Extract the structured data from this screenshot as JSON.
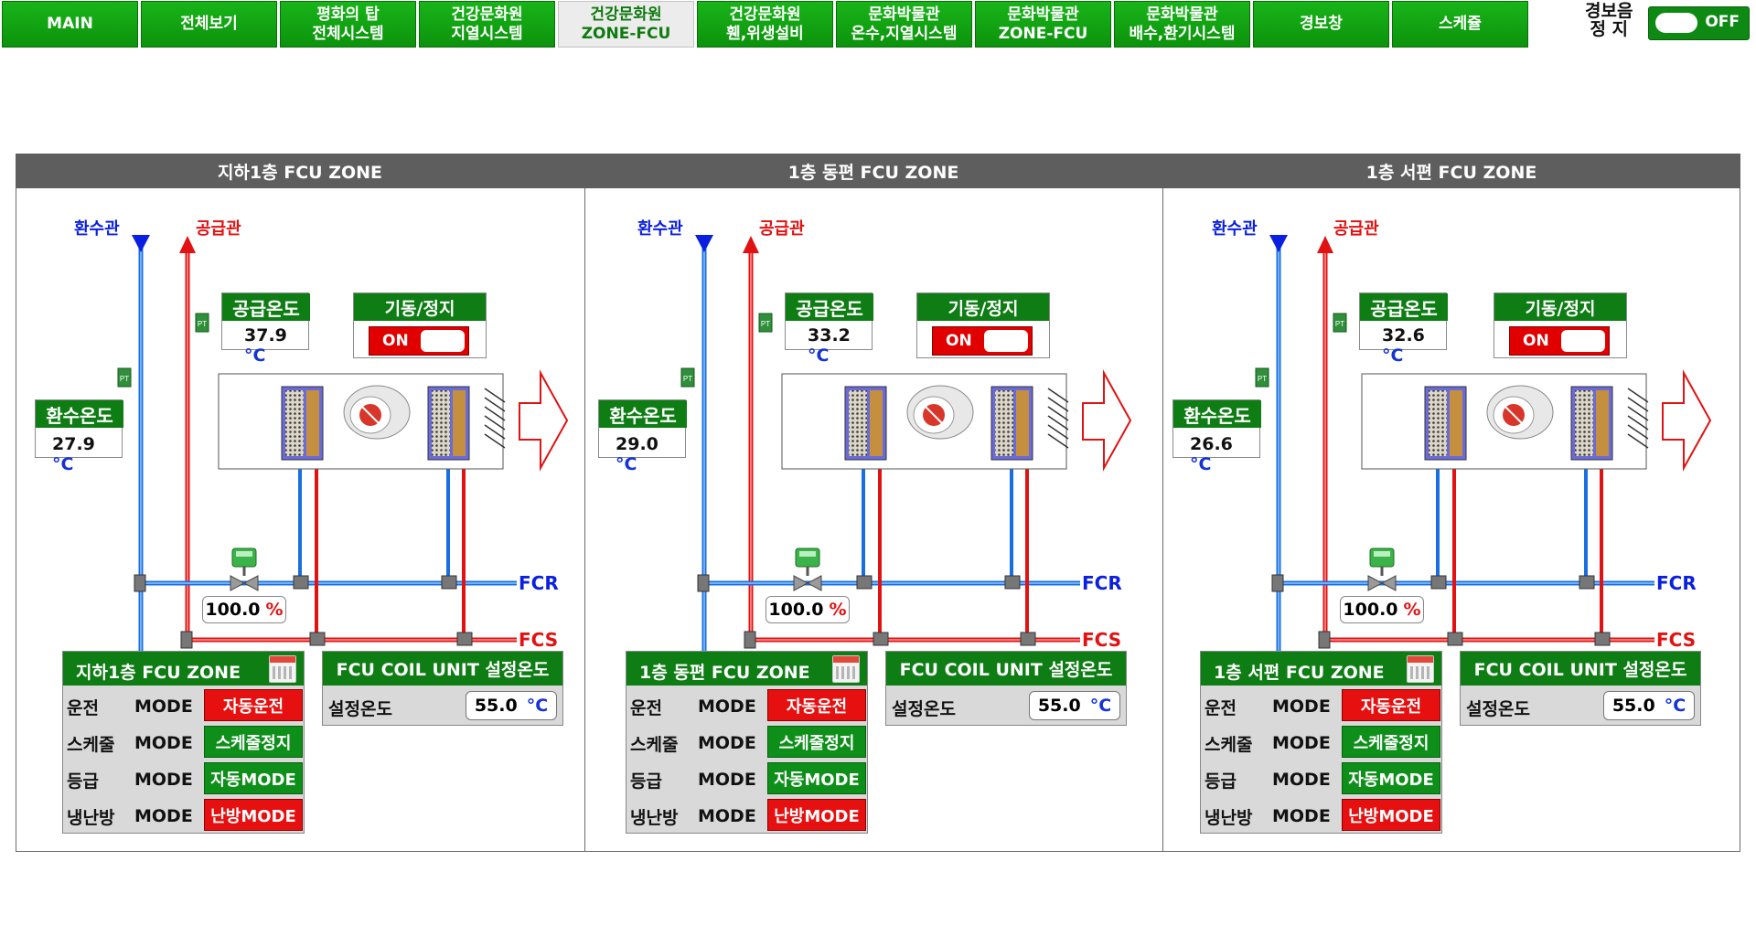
{
  "nav": {
    "items": [
      {
        "label": "MAIN"
      },
      {
        "label": "전체보기"
      },
      {
        "label": "평화의 탑\n전체시스템"
      },
      {
        "label": "건강문화원\n지열시스템"
      },
      {
        "label": "건강문화원\nZONE-FCU",
        "active": true
      },
      {
        "label": "건강문화원\n휀,위생설비"
      },
      {
        "label": "문화박물관\n온수,지열시스템"
      },
      {
        "label": "문화박물관\nZONE-FCU"
      },
      {
        "label": "문화박물관\n배수,환기시스템"
      },
      {
        "label": "경보창"
      },
      {
        "label": "스케쥴"
      }
    ],
    "alarm_label": "경보음\n정  지",
    "alarm_toggle": "OFF"
  },
  "colors": {
    "brand_green": "#0e7d14",
    "supply_red": "#e01212",
    "return_blue": "#0a1fe0"
  },
  "zones": [
    {
      "title": "지하1층 FCU ZONE",
      "return_pipe": "환수관",
      "supply_pipe": "공급관",
      "return_temp_label": "환수온도",
      "return_temp": "27.9",
      "supply_temp_label": "공급온도",
      "supply_temp": "37.9",
      "unit": "°C",
      "start_stop_label": "기동/정지",
      "start_stop_state": "ON",
      "valve_pct": "100.0",
      "pct_unit": "%",
      "fcr": "FCR",
      "fcs": "FCS",
      "panel_title": "지하1층 FCU ZONE",
      "rows": [
        {
          "label": "운전",
          "mode": "MODE",
          "value": "자동운전",
          "color": "red"
        },
        {
          "label": "스케줄",
          "mode": "MODE",
          "value": "스케줄정지",
          "color": "green"
        },
        {
          "label": "등급",
          "mode": "MODE",
          "value": "자동MODE",
          "color": "green"
        },
        {
          "label": "냉난방",
          "mode": "MODE",
          "value": "난방MODE",
          "color": "red"
        }
      ],
      "set_title": "FCU COIL UNIT 설정온도",
      "set_label": "설정온도",
      "set_value": "55.0"
    },
    {
      "title": "1층 동편 FCU ZONE",
      "return_pipe": "환수관",
      "supply_pipe": "공급관",
      "return_temp_label": "환수온도",
      "return_temp": "29.0",
      "supply_temp_label": "공급온도",
      "supply_temp": "33.2",
      "unit": "°C",
      "start_stop_label": "기동/정지",
      "start_stop_state": "ON",
      "valve_pct": "100.0",
      "pct_unit": "%",
      "fcr": "FCR",
      "fcs": "FCS",
      "panel_title": "1층 동편 FCU ZONE",
      "rows": [
        {
          "label": "운전",
          "mode": "MODE",
          "value": "자동운전",
          "color": "red"
        },
        {
          "label": "스케줄",
          "mode": "MODE",
          "value": "스케줄정지",
          "color": "green"
        },
        {
          "label": "등급",
          "mode": "MODE",
          "value": "자동MODE",
          "color": "green"
        },
        {
          "label": "냉난방",
          "mode": "MODE",
          "value": "난방MODE",
          "color": "red"
        }
      ],
      "set_title": "FCU COIL UNIT 설정온도",
      "set_label": "설정온도",
      "set_value": "55.0"
    },
    {
      "title": "1층 서편 FCU ZONE",
      "return_pipe": "환수관",
      "supply_pipe": "공급관",
      "return_temp_label": "환수온도",
      "return_temp": "26.6",
      "supply_temp_label": "공급온도",
      "supply_temp": "32.6",
      "unit": "°C",
      "start_stop_label": "기동/정지",
      "start_stop_state": "ON",
      "valve_pct": "100.0",
      "pct_unit": "%",
      "fcr": "FCR",
      "fcs": "FCS",
      "panel_title": "1층 서편 FCU ZONE",
      "rows": [
        {
          "label": "운전",
          "mode": "MODE",
          "value": "자동운전",
          "color": "red"
        },
        {
          "label": "스케줄",
          "mode": "MODE",
          "value": "스케줄정지",
          "color": "green"
        },
        {
          "label": "등급",
          "mode": "MODE",
          "value": "자동MODE",
          "color": "green"
        },
        {
          "label": "냉난방",
          "mode": "MODE",
          "value": "난방MODE",
          "color": "red"
        }
      ],
      "set_title": "FCU COIL UNIT 설정온도",
      "set_label": "설정온도",
      "set_value": "55.0"
    }
  ]
}
